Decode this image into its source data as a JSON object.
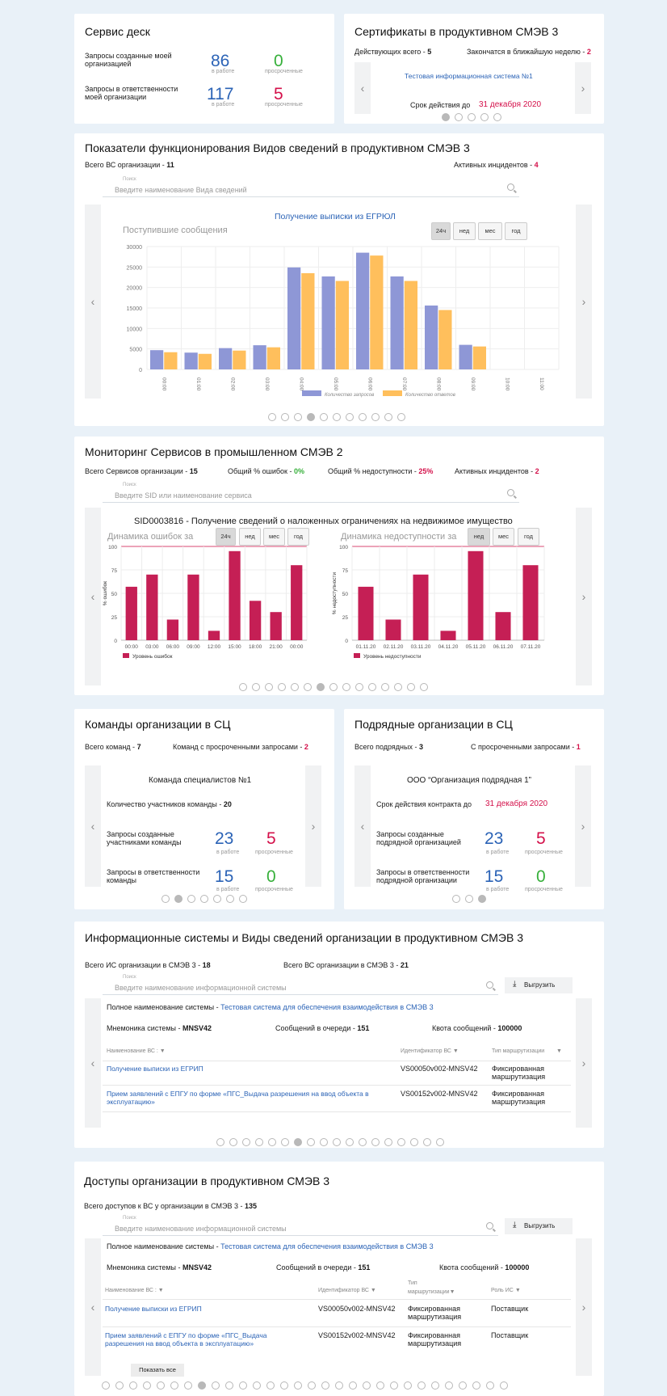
{
  "service_desk": {
    "title": "Сервис деск",
    "row1_label": "Запросы созданные моей организацией",
    "row1_work": "86",
    "row1_work_label": "в работе",
    "row1_over": "0",
    "row1_over_label": "просроченные",
    "row2_label": "Запросы в ответственности моей организации",
    "row2_work": "117",
    "row2_work_label": "в работе",
    "row2_over": "5",
    "row2_over_label": "просроченные"
  },
  "certs": {
    "title": "Сертификаты в продуктивном СМЭВ 3",
    "active_label": "Действующих всего - ",
    "active_value": "5",
    "expiring_label": "Закончатся в ближайшую неделю - ",
    "expiring_value": "2",
    "system_link": "Тестовая информационная система №1",
    "expiry_label": "Срок действия до",
    "expiry_value": "31 декабря 2020"
  },
  "vs_metrics": {
    "title": "Показатели функционирования Видов сведений в продуктивном СМЭВ 3",
    "total_label": "Всего ВС организации - ",
    "total_value": "11",
    "incidents_label": "Активных инцидентов - ",
    "incidents_value": "4",
    "search_label": "Поиск",
    "search_placeholder": "Введите наименование Вида сведений",
    "chart_title": "Получение выписки из ЕГРЮЛ",
    "chart_subtitle": "Поступившие сообщения",
    "periods": [
      "24ч",
      "нед",
      "мес",
      "год"
    ]
  },
  "monitoring": {
    "title": "Мониторинг Сервисов в промышленном СМЭВ 2",
    "total_label": "Всего Сервисов организации - ",
    "total_value": "15",
    "errors_label": "Общий % ошибок - ",
    "errors_value": "0%",
    "unavail_label": "Общий % недоступности - ",
    "unavail_value": "25%",
    "incidents_label": "Активных инцидентов - ",
    "incidents_value": "2",
    "search_label": "Поиск",
    "search_placeholder": "Введите SID или наименование сервиса",
    "service_title": "SID0003816 - Получение сведений о наложенных ограничениях на недвижимое имущество",
    "left_subtitle": "Динамика ошибок за",
    "right_subtitle": "Динамика недоступности за",
    "left_periods": [
      "24ч",
      "нед",
      "мес",
      "год"
    ],
    "right_periods": [
      "нед",
      "мес",
      "год"
    ]
  },
  "teams": {
    "title": "Команды организации в СЦ",
    "total_label": "Всего команд - ",
    "total_value": "7",
    "overdue_label": "Команд с просроченными запросами - ",
    "overdue_value": "2",
    "team_name": "Команда специалистов №1",
    "members_label": "Количество участников команды - ",
    "members_value": "20",
    "row1_label": "Запросы созданные участниками команды",
    "row1_work": "23",
    "row1_over": "5",
    "row2_label": "Запросы в ответственности команды",
    "row2_work": "15",
    "row2_over": "0",
    "work_label": "в работе",
    "over_label": "просроченные"
  },
  "contractors": {
    "title": "Подрядные организации в СЦ",
    "total_label": "Всего подрядных - ",
    "total_value": "3",
    "overdue_label": "С просроченными запросами - ",
    "overdue_value": "1",
    "org_name": "ООО “Организация подрядная 1”",
    "contract_label": "Срок действия контракта до",
    "contract_value": "31 декабря 2020",
    "row1_label": "Запросы созданные подрядной организацией",
    "row1_work": "23",
    "row1_over": "5",
    "row2_label": "Запросы в ответственности подрядной организации",
    "row2_work": "15",
    "row2_over": "0",
    "work_label": "в работе",
    "over_label": "просроченные"
  },
  "is_vs": {
    "title": "Информационные системы и Виды сведений организации в продуктивном СМЭВ 3",
    "is_total_label": "Всего ИС организации в СМЭВ 3 - ",
    "is_total_value": "18",
    "vs_total_label": "Всего ВС организации в СМЭВ 3 - ",
    "vs_total_value": "21",
    "search_label": "Поиск",
    "search_placeholder": "Введите наименование информационной системы",
    "export_label": "Выгрузить",
    "fullname_label": "Полное наименование системы - ",
    "fullname_value": "Тестовая система для обеспечения взаимодействия в СМЭВ 3",
    "mnemo_label": "Мнемоника системы - ",
    "mnemo_value": "MNSV42",
    "queue_label": "Сообщений в очереди - ",
    "queue_value": "151",
    "quota_label": "Квота сообщений - ",
    "quota_value": "100000",
    "col_name": "Наименование ВС",
    "col_id": "Идентификатор ВС",
    "col_route": "Тип маршрутизации",
    "rows": [
      {
        "name": "Получение выписки из ЕГРИП",
        "id": "VS00050v002-MNSV42",
        "route": "Фиксированная маршрутизация"
      },
      {
        "name": "Прием заявлений с ЕПГУ по форме «ПГС_Выдача разрешения на ввод объекта в эксплуатацию»",
        "id": "VS00152v002-MNSV42",
        "route": "Фиксированная маршрутизация"
      }
    ]
  },
  "access": {
    "title": "Доступы организации в продуктивном СМЭВ 3",
    "total_label": "Всего доступов к ВС у организации в СМЭВ 3 - ",
    "total_value": "135",
    "search_label": "Поиск",
    "search_placeholder": "Введите наименование информационной системы",
    "export_label": "Выгрузить",
    "fullname_label": "Полное наименование системы - ",
    "fullname_value": "Тестовая система для обеспечения взаимодействия в СМЭВ 3",
    "mnemo_label": "Мнемоника системы - ",
    "mnemo_value": "MNSV42",
    "queue_label": "Сообщений в очереди - ",
    "queue_value": "151",
    "quota_label": "Квота сообщений - ",
    "quota_value": "100000",
    "col_name": "Наименование ВС",
    "col_id": "Идентификатор ВС",
    "col_route_1": "Тип",
    "col_route_2": "маршрутизации",
    "col_role": "Роль ИС",
    "rows": [
      {
        "name": "Получение выписки из ЕГРИП",
        "id": "VS00050v002-MNSV42",
        "route": "Фиксированная маршрутизация",
        "role": "Поставщик"
      },
      {
        "name": "Прием заявлений с ЕПГУ по форме «ПГС_Выдача разрешения на ввод объекта в эксплуатацию»",
        "id": "VS00152v002-MNSV42",
        "route": "Фиксированная маршрутизация",
        "role": "Поставщик"
      }
    ],
    "show_all_label": "Показать все"
  },
  "colors": {
    "accent_blue": "#2b63b6",
    "bar_blue": "#8e97d6",
    "bar_orange": "#ffbf5c",
    "bar_crimson": "#c51f55",
    "green": "#37b03b",
    "red": "#d4104a"
  },
  "chart_data": [
    {
      "type": "bar",
      "title": "Получение выписки из ЕГРЮЛ",
      "subtitle": "Поступившие сообщения",
      "categories": [
        "00:00",
        "01:00",
        "02:00",
        "03:00",
        "04:00",
        "05:00",
        "06:00",
        "07:00",
        "08:00",
        "09:00",
        "10:00",
        "11:00"
      ],
      "series": [
        {
          "name": "Количество запросов",
          "values": [
            4700,
            4100,
            5200,
            5900,
            24900,
            22700,
            28500,
            22700,
            15600,
            6000,
            0,
            0
          ]
        },
        {
          "name": "Количество ответов",
          "values": [
            4200,
            3800,
            4600,
            5400,
            23500,
            21600,
            27800,
            21600,
            14500,
            5600,
            0,
            0
          ]
        }
      ],
      "yticks": [
        "0",
        "5000",
        "10000",
        "15000",
        "20000",
        "25000",
        "30000"
      ],
      "ylim": [
        0,
        30000
      ]
    },
    {
      "type": "bar",
      "title": "Динамика ошибок за",
      "ylabel": "% ошибок",
      "categories": [
        "00:00",
        "03:00",
        "06:00",
        "09:00",
        "12:00",
        "15:00",
        "18:00",
        "21:00",
        "00:00"
      ],
      "series": [
        {
          "name": "Уровень ошибок",
          "values": [
            57,
            70,
            22,
            70,
            10,
            95,
            42,
            30,
            80
          ]
        }
      ],
      "yticks": [
        "0",
        "25",
        "50",
        "75",
        "100"
      ],
      "ylim": [
        0,
        100
      ]
    },
    {
      "type": "bar",
      "title": "Динамика недоступности за",
      "ylabel": "% недоступности",
      "categories": [
        "01.11.20",
        "02.11.20",
        "03.11.20",
        "04.11.20",
        "05.11.20",
        "06.11.20",
        "07.11.20"
      ],
      "series": [
        {
          "name": "Уровень недоступности",
          "values": [
            57,
            22,
            70,
            10,
            95,
            30,
            80
          ]
        }
      ],
      "yticks": [
        "0",
        "25",
        "50",
        "75",
        "100"
      ],
      "ylim": [
        0,
        100
      ]
    }
  ]
}
